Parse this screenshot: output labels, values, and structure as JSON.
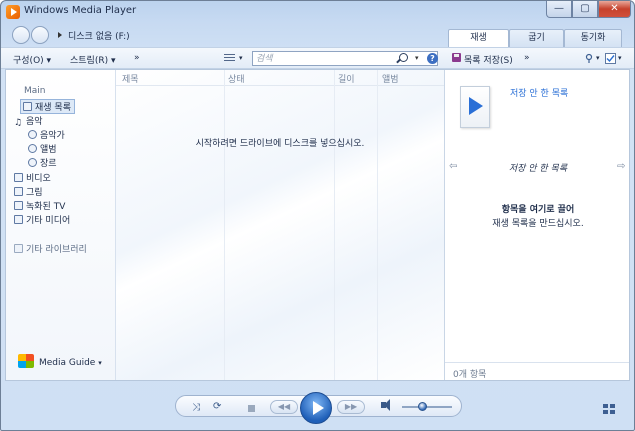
{
  "window": {
    "title": "Windows Media Player",
    "controls": {
      "minimize": "—",
      "maximize": "▢",
      "close": "✕"
    }
  },
  "nav": {
    "breadcrumb": "디스크 없음 (F:)"
  },
  "tabs": [
    {
      "label": "재생",
      "active": true
    },
    {
      "label": "굽기",
      "active": false
    },
    {
      "label": "동기화",
      "active": false
    }
  ],
  "toolbar": {
    "organize": "구성(O)",
    "stream": "스트림(R)",
    "more": "»",
    "search_placeholder": "검색",
    "help": "?",
    "save_list": "목록 저장(S)",
    "more_right": "»"
  },
  "sidebar": {
    "items": [
      {
        "label": "Main",
        "muted": true
      },
      {
        "label": "재생 목록",
        "selected": true
      },
      {
        "label": "음악"
      },
      {
        "label": "음악가"
      },
      {
        "label": "앨범"
      },
      {
        "label": "장르"
      },
      {
        "label": "비디오"
      },
      {
        "label": "그림"
      },
      {
        "label": "녹화된 TV"
      },
      {
        "label": "기타 미디어"
      },
      {
        "label": "기타 라이브러리",
        "muted": true
      }
    ],
    "guide": "Media Guide"
  },
  "list": {
    "columns": [
      "제목",
      "상태",
      "길이",
      "앨범"
    ],
    "empty_message": "시작하려면 드라이브에 디스크를 넣으십시오."
  },
  "playlist_pane": {
    "unsaved_top": "저장 안 한 목록",
    "title": "저장 안 한 목록",
    "drag_bold": "항목을 여기로 끌어",
    "drag_sub": "재생 목록을 만드십시오.",
    "count": "0개 항목"
  },
  "transport": {
    "volume_level": 0.4
  }
}
